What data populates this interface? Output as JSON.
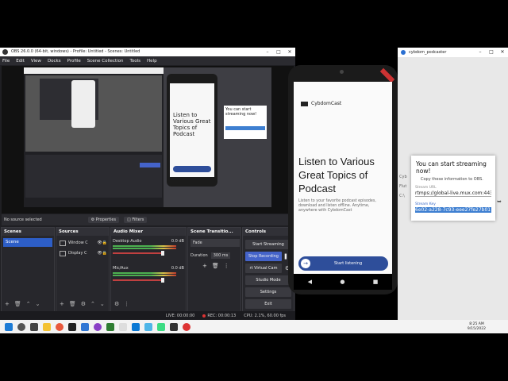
{
  "obs": {
    "title": "OBS 26.0.0 (64-bit, windows) - Profile: Untitled - Scenes: Untitled",
    "menu": [
      "File",
      "Edit",
      "View",
      "Docks",
      "Profile",
      "Scene Collection",
      "Tools",
      "Help"
    ],
    "no_source_selected": "No source selected",
    "properties_label": "Properties",
    "filters_label": "Filters",
    "scenes": {
      "title": "Scenes",
      "items": [
        "Scene"
      ]
    },
    "sources": {
      "title": "Sources",
      "items": [
        "Window C",
        "Display C"
      ]
    },
    "mixer": {
      "title": "Audio Mixer",
      "channels": [
        {
          "name": "Desktop Audio",
          "db": "0.0 dB"
        },
        {
          "name": "Mic/Aux",
          "db": "0.0 dB"
        }
      ]
    },
    "transitions": {
      "title": "Scene Transitio...",
      "type": "Fade",
      "duration_label": "Duration",
      "duration_value": "300 ms"
    },
    "controls": {
      "title": "Controls",
      "buttons": [
        "Start Streaming",
        "Stop Recording",
        "rt Virtual Cam",
        "Studio Mode",
        "Settings",
        "Exit"
      ]
    },
    "status": {
      "live": "LIVE: 00:00:00",
      "rec": "REC: 00:00:13",
      "cpu": "CPU: 2.1%, 60.00 fps"
    }
  },
  "phone": {
    "app_name": "CybdomCast",
    "headline": "Listen to Various Great Topics of Podcast",
    "body": "Listen to your favorite podcast episodes, download and listen offline. Anytime, anywhere with CybdomCast",
    "cta": "Start listening"
  },
  "cyb_window": {
    "title": "cybdom_podcaster",
    "dialog": {
      "title": "You can start streaming now!",
      "subtitle": "Copy these information to OBS.",
      "url_label": "Stream URL",
      "url_value": "rtmps://global-live.mux.com:443/",
      "key_label": "Stream Key",
      "key_value": "6e02-a228-7c93-eee27fe27b01"
    }
  },
  "taskbar": {
    "time": "8:25 AM",
    "date": "9/15/2022",
    "icons": [
      "start",
      "search",
      "taskview",
      "files",
      "chrome",
      "obs",
      "edge",
      "store",
      "mail",
      "vscode",
      "flutter",
      "android-studio",
      "terminal",
      "recorder"
    ]
  },
  "colors": {
    "obs_bg": "#1f1f23",
    "accent": "#2d5ec7",
    "stop_rec": "#4463c9",
    "cta_blue": "#2e4e9a"
  }
}
